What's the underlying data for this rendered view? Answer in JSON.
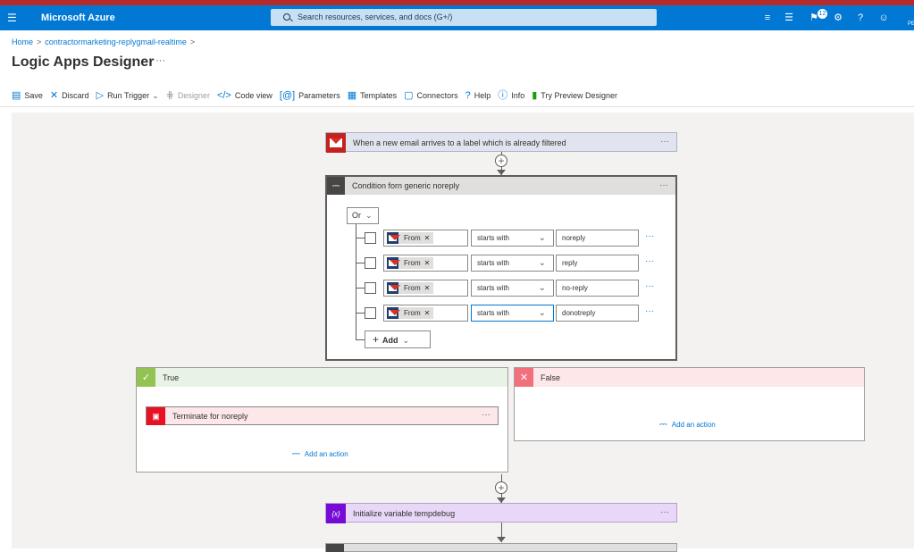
{
  "topbar": {
    "menu_icon": "hamburger-icon",
    "brand": "Microsoft Azure",
    "search_placeholder": "Search resources, services, and docs (G+/)",
    "notification_count": "12",
    "preview_tag": "PE"
  },
  "breadcrumb": {
    "home": "Home",
    "resource": "contractormarketing-replygmail-realtime",
    "sep": ">"
  },
  "page": {
    "title": "Logic Apps Designer",
    "more": "···"
  },
  "toolbar": {
    "save": "Save",
    "discard": "Discard",
    "run_trigger": "Run Trigger",
    "designer": "Designer",
    "code_view": "Code view",
    "parameters": "Parameters",
    "templates": "Templates",
    "connectors": "Connectors",
    "help": "Help",
    "info": "Info",
    "try_preview": "Try Preview Designer"
  },
  "trigger": {
    "label": "When a new email arrives to a label which is already filtered",
    "more": "···"
  },
  "condition": {
    "label": "Condition forn generic noreply",
    "more": "···",
    "group_operator": "Or",
    "rows": [
      {
        "field": "From",
        "operator": "starts with",
        "value": "noreply"
      },
      {
        "field": "From",
        "operator": "starts with",
        "value": "reply"
      },
      {
        "field": "From",
        "operator": "starts with",
        "value": "no-reply"
      },
      {
        "field": "From",
        "operator": "starts with",
        "value": "donotreply"
      }
    ],
    "add_label": "Add"
  },
  "true_branch": {
    "label": "True",
    "action_label": "Terminate for noreply",
    "action_more": "···",
    "add_action": "Add an action"
  },
  "false_branch": {
    "label": "False",
    "add_action": "Add an action"
  },
  "init_variable": {
    "label": "Initialize variable tempdebug",
    "more": "···"
  },
  "colors": {
    "azure_blue": "#0078d4",
    "true_header": "#e8f3e6",
    "false_header": "#fde7e9",
    "terminate_red": "#e81123",
    "variable_purple": "#770bd6"
  }
}
